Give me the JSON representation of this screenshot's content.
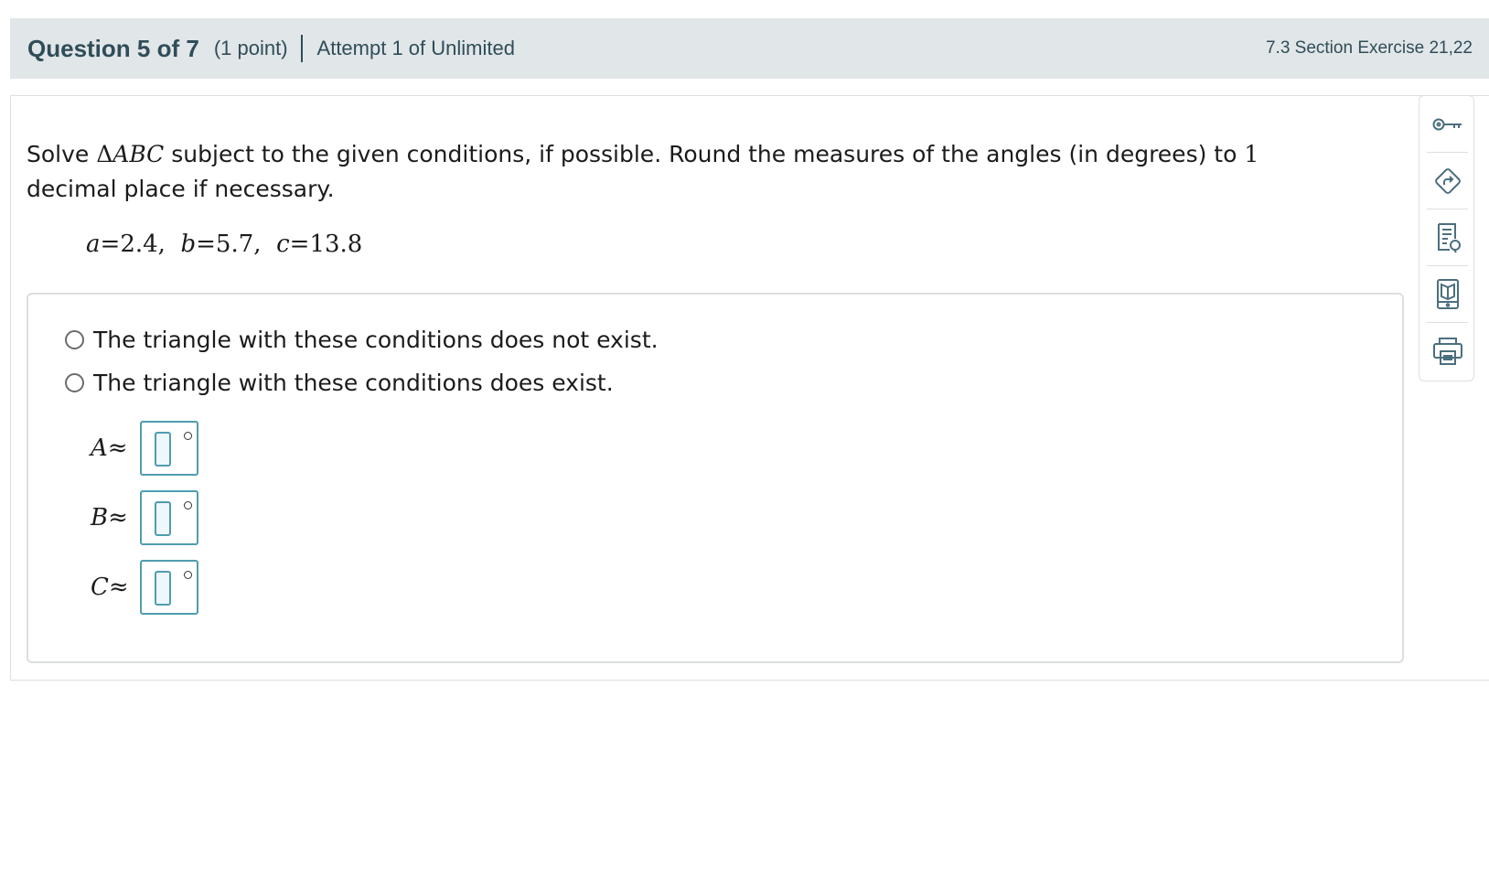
{
  "header": {
    "question_title": "Question 5 of 7",
    "points": "(1 point)",
    "attempt": "Attempt 1 of Unlimited",
    "section": "7.3 Section Exercise 21,22"
  },
  "question": {
    "prompt_prefix": "Solve ",
    "triangle_symbol": "Δ",
    "triangle_name": "ABC",
    "prompt_middle": " subject to the given conditions, if possible. Round the measures of the angles (in degrees) to ",
    "decimal_places": "1",
    "prompt_suffix": " decimal place if necessary.",
    "givens": {
      "a_var": "a",
      "a_val": "2.4",
      "b_var": "b",
      "b_val": "5.7",
      "c_var": "c",
      "c_val": "13.8"
    }
  },
  "options": [
    {
      "label": "The triangle with these conditions does not exist."
    },
    {
      "label": "The triangle with these conditions does exist."
    }
  ],
  "angles": [
    {
      "var": "A",
      "symbol": "≈",
      "value": ""
    },
    {
      "var": "B",
      "symbol": "≈",
      "value": ""
    },
    {
      "var": "C",
      "symbol": "≈",
      "value": ""
    }
  ],
  "toolbar": {
    "icons": [
      "key-icon",
      "share-arrow-icon",
      "hint-icon",
      "textbook-icon",
      "print-icon"
    ]
  },
  "colors": {
    "header_bg": "#e1e6e8",
    "header_text": "#2f4d58",
    "input_border": "#4f9db0",
    "icon_stroke": "#4b6f7d"
  }
}
